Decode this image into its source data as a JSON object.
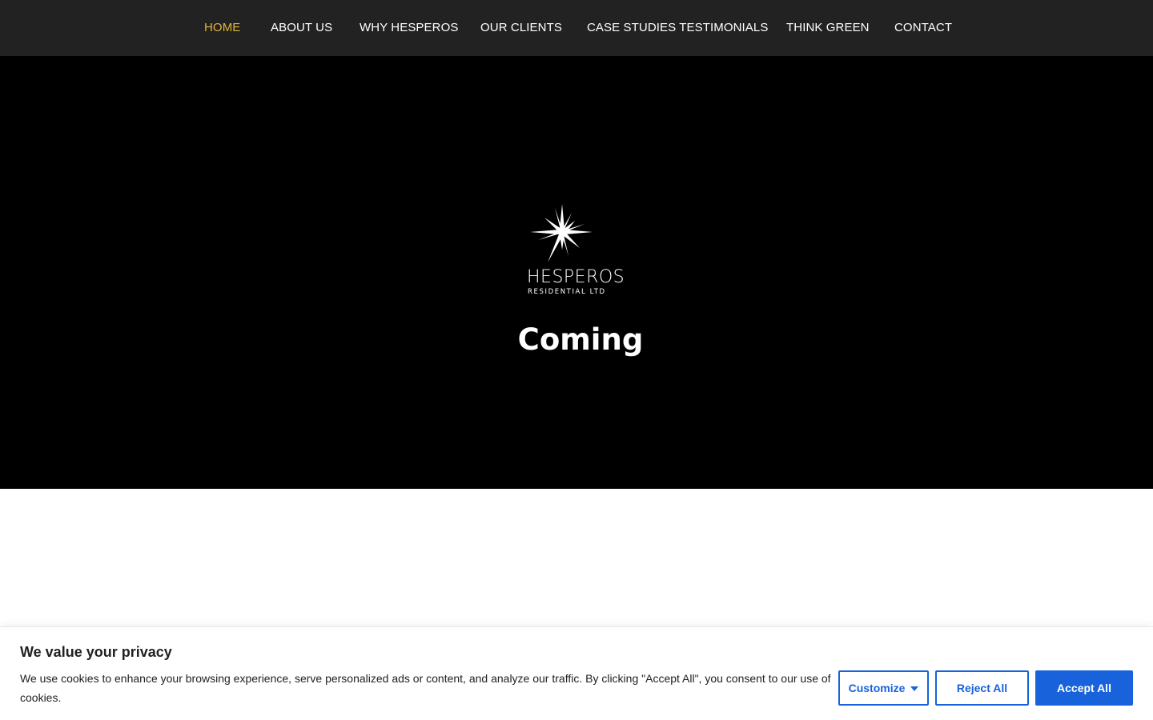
{
  "nav": {
    "items": [
      {
        "label": "HOME",
        "active": true
      },
      {
        "label": "ABOUT US",
        "active": false
      },
      {
        "label": "WHY HESPEROS",
        "active": false
      },
      {
        "label": "OUR CLIENTS",
        "active": false
      },
      {
        "label": "CASE STUDIES TESTIMONIALS",
        "active": false
      },
      {
        "label": "THINK GREEN",
        "active": false
      },
      {
        "label": "CONTACT",
        "active": false
      }
    ]
  },
  "hero": {
    "logo_name": "HESPEROS",
    "logo_sub": "RESIDENTIAL LTD",
    "logo_icon": "star-burst-icon",
    "title": "Coming"
  },
  "cookie": {
    "title": "We value your privacy",
    "text": "We use cookies to enhance your browsing experience, serve personalized ads or content, and analyze our traffic. By clicking \"Accept All\", you consent to our use of cookies.",
    "customize_label": "Customize",
    "reject_label": "Reject All",
    "accept_label": "Accept All"
  },
  "colors": {
    "nav_bg": "#222222",
    "nav_active": "#e0b53a",
    "hero_bg": "#000000",
    "accent": "#1863dc"
  }
}
